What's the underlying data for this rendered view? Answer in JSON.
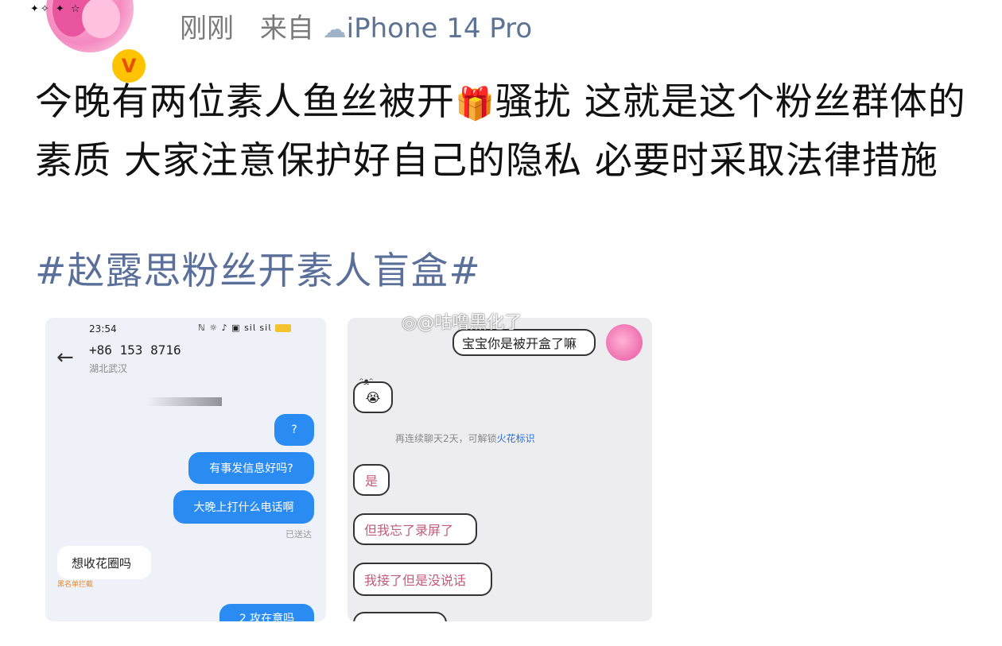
{
  "header": {
    "time_label": "刚刚",
    "source_prefix": "来自",
    "cloud_icon": "cloud-icon",
    "device": "iPhone 14 Pro",
    "badge_letter": "V",
    "sparkles": "✦✧ ✦ ☆"
  },
  "post": {
    "text_part1": "今晚有两位素人鱼丝被开",
    "gift_icon": "🎁",
    "text_part2": "骚扰 这就是这个粉丝群体的素质 大家注意保护好自己的隐私 必要时采取法律措施",
    "hashtag": "#赵露思粉丝开素人盲盒#"
  },
  "left_screenshot": {
    "status_time": "23:54",
    "status_icons": "ℕ ☼ ♪ ▣ 𝗌𝗂𝗅 𝗌𝗂𝗅",
    "battery": "56",
    "back_icon": "back-arrow-icon",
    "phone": "+86 153 8716",
    "location": "湖北武汉",
    "messages_out": [
      "?",
      "有事发信息好吗?",
      "大晚上打什么电话啊"
    ],
    "delivered": "已送达",
    "message_in": "想收花圈吗",
    "note": "黑名单拦截",
    "partial_out": "2 攻在意吗"
  },
  "right_screenshot": {
    "watermark": "@咕噜黑化了",
    "weibo_icon": "weibo-logo-icon",
    "top_message": "宝宝你是被开盒了嘛",
    "emoji": "😭",
    "tip_prefix": "再连续聊天2天，可解锁",
    "tip_link": "火花标识",
    "replies": [
      "是",
      "但我忘了录屏了",
      "我接了但是没说话"
    ]
  },
  "colors": {
    "hashtag": "#5a6f99",
    "meta": "#7a7a7a",
    "sms_blue": "#2a8cf3",
    "badge": "#ffc300"
  }
}
